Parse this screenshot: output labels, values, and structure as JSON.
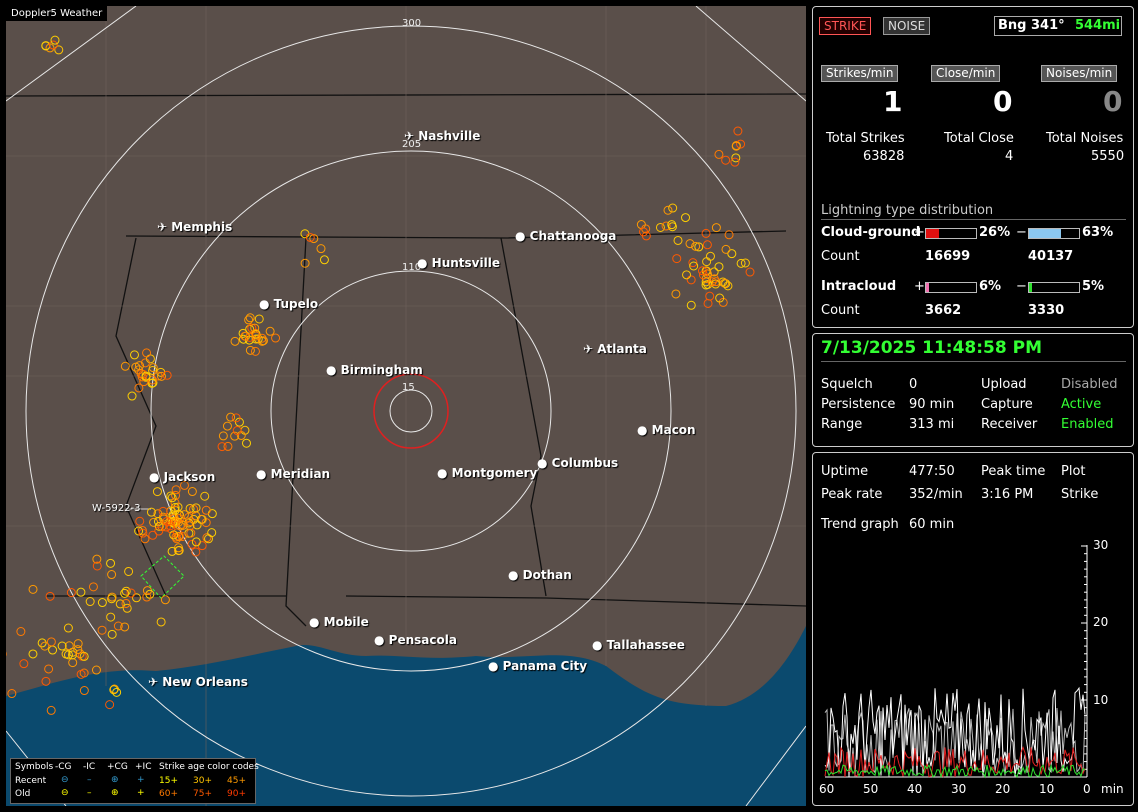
{
  "app_title": "Doppler5 Weather",
  "map": {
    "range_labels": [
      "300",
      "205",
      "110",
      "15"
    ],
    "cities": [
      {
        "name": "Nashville",
        "airport": true
      },
      {
        "name": "Memphis",
        "airport": true
      },
      {
        "name": "Chattanooga",
        "airport": false
      },
      {
        "name": "Huntsville",
        "airport": false
      },
      {
        "name": "Tupelo",
        "airport": false
      },
      {
        "name": "Atlanta",
        "airport": true
      },
      {
        "name": "Birmingham",
        "airport": false
      },
      {
        "name": "Macon",
        "airport": false
      },
      {
        "name": "Jackson",
        "airport": false
      },
      {
        "name": "Meridian",
        "airport": false
      },
      {
        "name": "Montgomery",
        "airport": false
      },
      {
        "name": "Columbus",
        "airport": false
      },
      {
        "name": "Dothan",
        "airport": false
      },
      {
        "name": "Mobile",
        "airport": false
      },
      {
        "name": "Pensacola",
        "airport": false
      },
      {
        "name": "Tallahassee",
        "airport": false
      },
      {
        "name": "Panama City",
        "airport": false
      },
      {
        "name": "New Orleans",
        "airport": true
      }
    ],
    "warning_label": "W-5922-3",
    "legend": {
      "symbols_label": "Symbols",
      "cols": [
        "-CG",
        "-IC",
        "+CG",
        "+IC"
      ],
      "age_label": "Strike age color codes",
      "recent_label": "Recent",
      "old_label": "Old",
      "recent_ages": [
        "15+",
        "30+",
        "45+"
      ],
      "old_ages": [
        "60+",
        "75+",
        "90+"
      ]
    }
  },
  "header": {
    "strike_btn": "STRIKE",
    "noise_btn": "NOISE",
    "bearing": "Bng 341°",
    "distance": "544mi"
  },
  "rates": {
    "strikes_label": "Strikes/min",
    "strikes_value": "1",
    "close_label": "Close/min",
    "close_value": "0",
    "noises_label": "Noises/min",
    "noises_value": "0"
  },
  "totals": {
    "strikes_label": "Total Strikes",
    "strikes_value": "63828",
    "close_label": "Total Close",
    "close_value": "4",
    "noises_label": "Total Noises",
    "noises_value": "5550"
  },
  "distribution": {
    "title": "Lightning type distribution",
    "cg_label": "Cloud-ground",
    "cg_pos_pct": "26%",
    "cg_neg_pct": "63%",
    "cg_pos_fill": 0.26,
    "cg_neg_fill": 0.63,
    "count_label": "Count",
    "cg_pos_count": "16699",
    "cg_neg_count": "40137",
    "ic_label": "Intracloud",
    "ic_pos_pct": "6%",
    "ic_neg_pct": "5%",
    "ic_pos_fill": 0.06,
    "ic_neg_fill": 0.05,
    "ic_pos_count": "3662",
    "ic_neg_count": "3330",
    "plus": "+",
    "minus": "−"
  },
  "status": {
    "datetime": "7/13/2025 11:48:58 PM",
    "squelch_label": "Squelch",
    "squelch_value": "0",
    "upload_label": "Upload",
    "upload_value": "Disabled",
    "persistence_label": "Persistence",
    "persistence_value": "90 min",
    "capture_label": "Capture",
    "capture_value": "Active",
    "range_label": "Range",
    "range_value": "313 mi",
    "receiver_label": "Receiver",
    "receiver_value": "Enabled"
  },
  "trend": {
    "uptime_label": "Uptime",
    "uptime_value": "477:50",
    "peak_time_label": "Peak time",
    "plot_label": "Plot",
    "peak_rate_label": "Peak rate",
    "peak_rate_value": "352/min",
    "peak_time_value": "3:16 PM",
    "plot_value": "Strike",
    "trend_label": "Trend graph",
    "trend_value": "60 min",
    "x_ticks": [
      "60",
      "50",
      "40",
      "30",
      "20",
      "10",
      "0"
    ],
    "x_unit": "min",
    "y_ticks": [
      "30",
      "20",
      "10"
    ]
  },
  "colors": {
    "accent_green": "#33ff33",
    "strike_red": "#ff3333",
    "map_bg": "#5a4f4a",
    "water": "#0b4a6e",
    "ring": "#e8e8e8"
  }
}
